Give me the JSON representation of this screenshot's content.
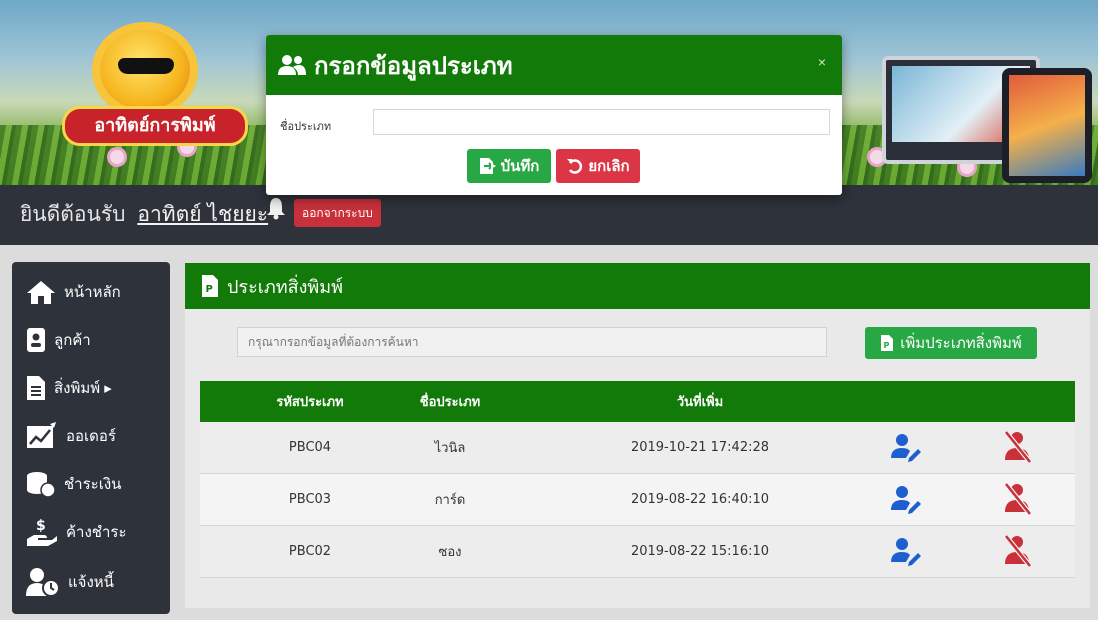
{
  "header": {
    "logo_text": "อาทิตย์การพิมพ์"
  },
  "welcome": {
    "greeting": "ยินดีต้อนรับ",
    "user": "อาทิตย์ ไชยยะ",
    "logout_label": "ออกจากระบบ"
  },
  "sidebar": {
    "items": [
      {
        "label": "หน้าหลัก",
        "icon": "home-icon"
      },
      {
        "label": "ลูกค้า",
        "icon": "id-badge-icon"
      },
      {
        "label": "สิ่งพิมพ์ ▸",
        "icon": "file-icon"
      },
      {
        "label": "ออเดอร์",
        "icon": "chart-icon"
      },
      {
        "label": "ชำระเงิน",
        "icon": "coins-icon"
      },
      {
        "label": "ค้างชำระ",
        "icon": "dollar-hand-icon"
      },
      {
        "label": "แจ้งหนี้",
        "icon": "user-clock-icon"
      }
    ]
  },
  "panel": {
    "title": "ประเภทสิ่งพิมพ์",
    "search_placeholder": "กรุณากรอกข้อมูลที่ต้องการค้นหา",
    "add_label": "เพิ่มประเภทสิ่งพิมพ์"
  },
  "table": {
    "headers": [
      "รหัสประเภท",
      "ชื่อประเภท",
      "วันที่เพิ่ม"
    ],
    "rows": [
      {
        "code": "PBC04",
        "name": "ไวนิล",
        "date": "2019-10-21 17:42:28"
      },
      {
        "code": "PBC03",
        "name": "การ์ด",
        "date": "2019-08-22 16:40:10"
      },
      {
        "code": "PBC02",
        "name": "ซอง",
        "date": "2019-08-22 15:16:10"
      }
    ]
  },
  "modal": {
    "title": "กรอกข้อมูลประเภท",
    "close": "×",
    "field_label": "ชื่อประเภท",
    "field_value": "",
    "save_label": "บันทึก",
    "cancel_label": "ยกเลิก"
  },
  "colors": {
    "primary_green": "#127a08",
    "button_green": "#28a745",
    "danger_red": "#dc3545",
    "dark": "#2e323a",
    "edit_blue": "#1e5fd0"
  }
}
